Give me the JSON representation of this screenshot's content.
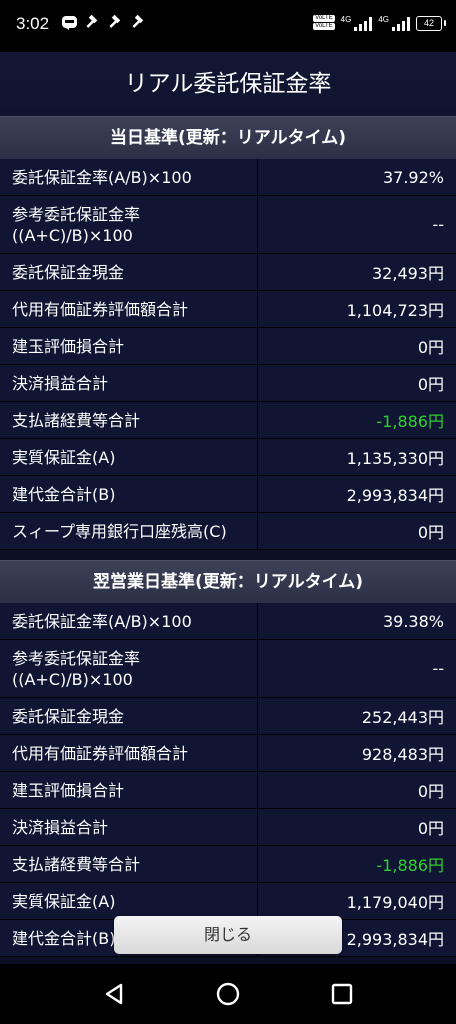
{
  "status_bar": {
    "time": "3:02",
    "left_icons": [
      "line-app-icon",
      "hammer-icon",
      "hammer-icon",
      "hammer-icon"
    ],
    "volte1": "VoLTE",
    "volte2": "VoLTE",
    "net1": "4G",
    "net2": "4G",
    "battery": "42"
  },
  "page": {
    "title": "リアル委託保証金率"
  },
  "sections": [
    {
      "header": "当日基準(更新：リアルタイム)",
      "rows": [
        {
          "label": "委託保証金率(A/B)×100",
          "value": "37.92%"
        },
        {
          "label": "参考委託保証金率\n((A+C)/B)×100",
          "value": "--"
        },
        {
          "label": "委託保証金現金",
          "value": "32,493円"
        },
        {
          "label": "代用有価証券評価額合計",
          "value": "1,104,723円"
        },
        {
          "label": "建玉評価損合計",
          "value": "0円"
        },
        {
          "label": "決済損益合計",
          "value": "0円"
        },
        {
          "label": "支払諸経費等合計",
          "value": "-1,886円"
        },
        {
          "label": "実質保証金(A)",
          "value": "1,135,330円"
        },
        {
          "label": "建代金合計(B)",
          "value": "2,993,834円"
        },
        {
          "label": "スィープ専用銀行口座残高(C)",
          "value": "0円"
        }
      ]
    },
    {
      "header": "翌営業日基準(更新：リアルタイム)",
      "rows": [
        {
          "label": "委託保証金率(A/B)×100",
          "value": "39.38%"
        },
        {
          "label": "参考委託保証金率\n((A+C)/B)×100",
          "value": "--"
        },
        {
          "label": "委託保証金現金",
          "value": "252,443円"
        },
        {
          "label": "代用有価証券評価額合計",
          "value": "928,483円"
        },
        {
          "label": "建玉評価損合計",
          "value": "0円"
        },
        {
          "label": "決済損益合計",
          "value": "0円"
        },
        {
          "label": "支払諸経費等合計",
          "value": "-1,886円"
        },
        {
          "label": "実質保証金(A)",
          "value": "1,179,040円"
        },
        {
          "label": "建代金合計(B)",
          "value": "2,993,834円"
        }
      ]
    }
  ],
  "close_button": {
    "label": "閉じる"
  },
  "nav": {
    "back": "back-icon",
    "home": "home-icon",
    "recents": "recents-icon"
  },
  "colors": {
    "background": "#0c1024",
    "row_background": "#0f1533",
    "negative_value": "#2ed12e"
  }
}
